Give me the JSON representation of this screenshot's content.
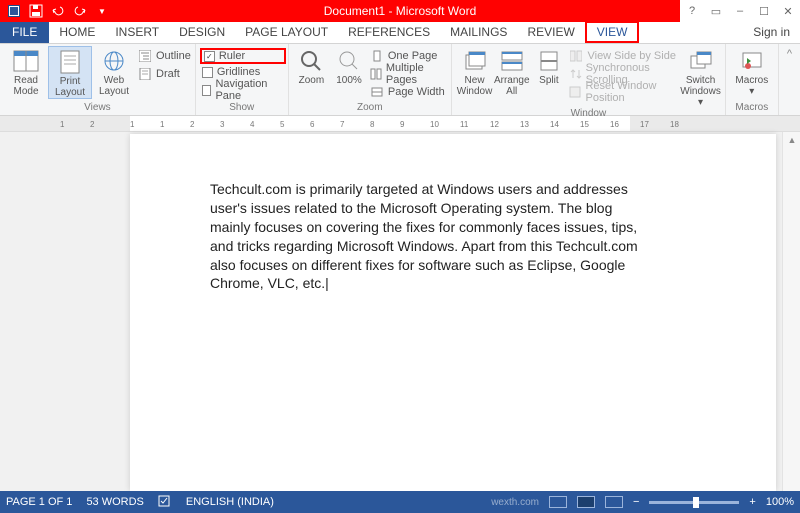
{
  "title": "Document1 - Microsoft Word",
  "tabs": {
    "file": "FILE",
    "items": [
      "HOME",
      "INSERT",
      "DESIGN",
      "PAGE LAYOUT",
      "REFERENCES",
      "MAILINGS",
      "REVIEW",
      "VIEW"
    ],
    "signin": "Sign in"
  },
  "ribbon": {
    "views": {
      "label": "Views",
      "read": "Read Mode",
      "print": "Print Layout",
      "web": "Web Layout",
      "outline": "Outline",
      "draft": "Draft"
    },
    "show": {
      "label": "Show",
      "ruler": "Ruler",
      "gridlines": "Gridlines",
      "nav": "Navigation Pane"
    },
    "zoom": {
      "label": "Zoom",
      "zoom": "Zoom",
      "pct": "100%",
      "one": "One Page",
      "multi": "Multiple Pages",
      "width": "Page Width"
    },
    "window": {
      "label": "Window",
      "new": "New Window",
      "arrange": "Arrange All",
      "split": "Split",
      "side": "View Side by Side",
      "sync": "Synchronous Scrolling",
      "reset": "Reset Window Position",
      "switch": "Switch Windows"
    },
    "macros": {
      "label": "Macros",
      "btn": "Macros"
    }
  },
  "document": {
    "body": "Techcult.com is primarily targeted at Windows users and addresses user's issues related to the Microsoft Operating system. The blog mainly focuses on covering the fixes for commonly faces issues, tips, and tricks regarding Microsoft Windows. Apart from this Techcult.com also focuses on different fixes for software such as Eclipse, Google Chrome, VLC, etc.|"
  },
  "ruler_ticks": [
    "1",
    "2",
    "1",
    "1",
    "2",
    "3",
    "4",
    "5",
    "6",
    "7",
    "8",
    "9",
    "10",
    "11",
    "12",
    "13",
    "14",
    "15",
    "16",
    "17",
    "18"
  ],
  "status": {
    "page": "PAGE 1 OF 1",
    "words": "53 WORDS",
    "lang": "ENGLISH (INDIA)",
    "zoom": "100%"
  }
}
